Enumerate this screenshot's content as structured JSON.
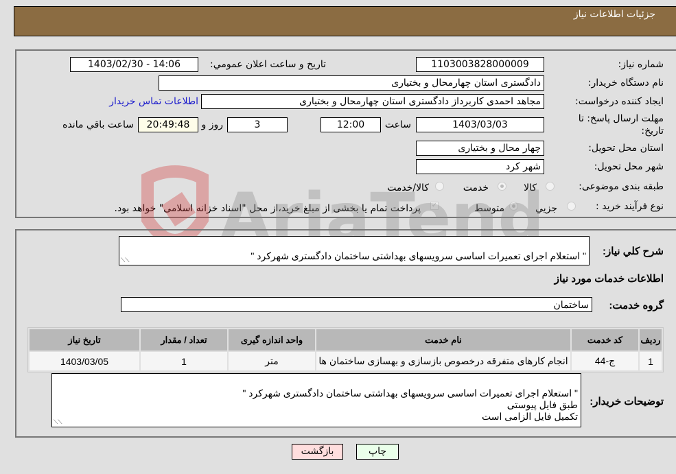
{
  "header": {
    "title": "جزئیات اطلاعات نیاز"
  },
  "details": {
    "need_number": {
      "label": "شماره نیاز:",
      "value": "1103003828000009"
    },
    "announce_datetime": {
      "label": "تاریخ و ساعت اعلان عمومي:",
      "value": "1403/02/30 - 14:06"
    },
    "buyer_org": {
      "label": "نام دستگاه خریدار:",
      "value": "دادگستری استان چهارمحال و بختیاری"
    },
    "requester": {
      "label": "ایجاد کننده درخواست:",
      "value": "مجاهد احمدی کاربرداز دادگستری استان چهارمحال و بختیاری"
    },
    "buyer_contact_link": "اطلاعات تماس خریدار",
    "deadline": {
      "label": "مهلت ارسال پاسخ: تا تاریخ:",
      "date": "1403/03/03",
      "time_label": "ساعت",
      "time": "12:00",
      "days": "3",
      "days_label": "روز و",
      "remaining": "20:49:48",
      "remaining_label": "ساعت باقي مانده"
    },
    "delivery_province": {
      "label": "استان محل تحویل:",
      "value": "چهار محال و بختیاری"
    },
    "delivery_city": {
      "label": "شهر محل تحویل:",
      "value": "شهر کرد"
    },
    "category": {
      "label": "طبقه بندی موضوعی:",
      "options": [
        "کالا",
        "خدمت",
        "کالا/خدمت"
      ],
      "selected": "خدمت"
    },
    "purchase_type": {
      "label": "نوع فرآیند خرید :",
      "options": [
        "جزيي",
        "متوسط"
      ],
      "selected": "متوسط",
      "treasury_note": "پرداخت تمام یا بخشی از مبلغ خرید،از محل \"اسناد خزانه اسلامی\" خواهد بود."
    }
  },
  "description": {
    "label": "شرح کلي نیاز:",
    "value": "\" استعلام اجرای تعمیرات اساسی سرویسهای بهداشتی ساختمان دادگستری شهرکرد \""
  },
  "services_section": {
    "title": "اطلاعات خدمات مورد نیاز",
    "group_label": "گروه خدمت:",
    "group_value": "ساختمان",
    "table": {
      "columns": [
        "ردیف",
        "کد خدمت",
        "نام خدمت",
        "واحد اندازه گیری",
        "تعداد / مقدار",
        "تاریخ نیاز"
      ],
      "rows": [
        [
          "1",
          "ج-44",
          "انجام کارهای متفرقه درخصوص بازسازی و بهسازی ساختمان ها",
          "متر",
          "1",
          "1403/03/05"
        ]
      ]
    }
  },
  "buyer_notes": {
    "label": "توضیحات خریدار:",
    "value": "\" استعلام اجرای تعمیرات اساسی سرویسهای بهداشتی ساختمان دادگستری شهرکرد \"\nطبق فایل پیوستی\nتکمیل فایل الزامی است"
  },
  "buttons": {
    "print": "چاپ",
    "back": "بازگشت"
  },
  "colors": {
    "header_bg": "#8b6c42",
    "print_bg": "#eaffea",
    "back_bg": "#ffdede",
    "link": "#1a1acc"
  },
  "watermark": {
    "text": "AriaTender.neT"
  }
}
